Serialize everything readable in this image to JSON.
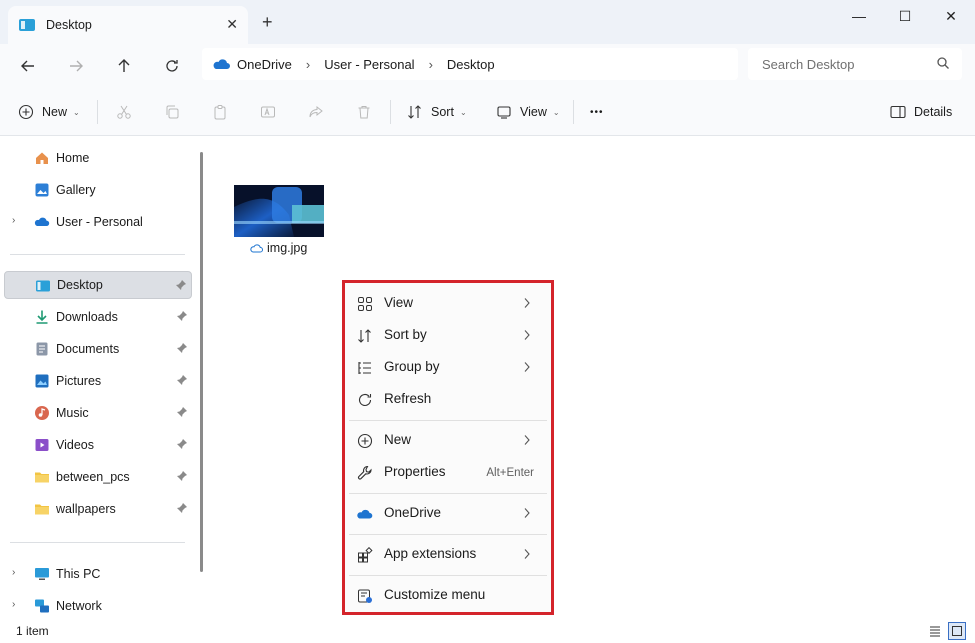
{
  "window": {
    "tab_title": "Desktop",
    "tab_close": "✕",
    "new_tab": "+",
    "minimize": "—",
    "maximize": "☐",
    "close": "✕"
  },
  "address": {
    "breadcrumbs": [
      "OneDrive",
      "User - Personal",
      "Desktop"
    ],
    "separator": "›",
    "search_placeholder": "Search Desktop"
  },
  "toolbar": {
    "new_label": "New",
    "sort_label": "Sort",
    "view_label": "View",
    "more_label": "•••",
    "details_label": "Details",
    "caret": "⌄"
  },
  "sidebar": {
    "chevron": "›",
    "items": [
      {
        "label": "Home"
      },
      {
        "label": "Gallery"
      },
      {
        "label": "User - Personal"
      },
      {
        "label": "Desktop"
      },
      {
        "label": "Downloads"
      },
      {
        "label": "Documents"
      },
      {
        "label": "Pictures"
      },
      {
        "label": "Music"
      },
      {
        "label": "Videos"
      },
      {
        "label": "between_pcs"
      },
      {
        "label": "wallpapers"
      },
      {
        "label": "This PC"
      },
      {
        "label": "Network"
      }
    ]
  },
  "files": [
    {
      "name": "img.jpg"
    }
  ],
  "context_menu": {
    "items": [
      {
        "label": "View"
      },
      {
        "label": "Sort by"
      },
      {
        "label": "Group by"
      },
      {
        "label": "Refresh"
      },
      {
        "label": "New"
      },
      {
        "label": "Properties",
        "shortcut": "Alt+Enter"
      },
      {
        "label": "OneDrive"
      },
      {
        "label": "App extensions"
      },
      {
        "label": "Customize menu"
      }
    ]
  },
  "status": {
    "item_count": "1 item"
  },
  "colors": {
    "highlight_border": "#d4242b",
    "onedrive_blue": "#1e74d0",
    "folder_yellow": "#f2c443"
  }
}
